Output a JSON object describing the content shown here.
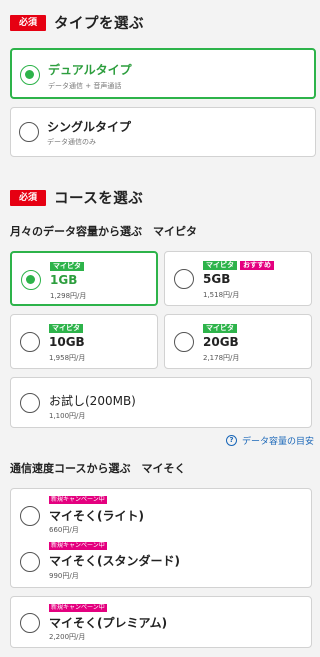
{
  "type_section": {
    "required": "必須",
    "title": "タイプを選ぶ",
    "options": [
      {
        "name": "デュアルタイプ",
        "desc": "データ通信 + 音声通話",
        "selected": true
      },
      {
        "name": "シングルタイプ",
        "desc": "データ通信のみ",
        "selected": false
      }
    ]
  },
  "course_section": {
    "required": "必須",
    "title": "コースを選ぶ",
    "capacity_heading": "月々のデータ容量から選ぶ　マイピタ",
    "badge_mypita": "マイピタ",
    "badge_recommended": "おすすめ",
    "plans": [
      {
        "name": "1GB",
        "price": "1,298円/月",
        "selected": true
      },
      {
        "name": "5GB",
        "price": "1,518円/月",
        "selected": false
      },
      {
        "name": "10GB",
        "price": "1,958円/月",
        "selected": false
      },
      {
        "name": "20GB",
        "price": "2,178円/月",
        "selected": false
      },
      {
        "name": "お試し(200MB)",
        "price": "1,100円/月",
        "selected": false
      }
    ],
    "help_link": "データ容量の目安",
    "speed_heading": "通信速度コースから選ぶ　マイそく",
    "campaign_badge": "新規キャンペーン中",
    "speed_plans": [
      {
        "name": "マイそく(ライト)",
        "price": "660円/月"
      },
      {
        "name": "マイそく(スタンダード)",
        "price": "990円/月"
      },
      {
        "name": "マイそく(プレミアム)",
        "price": "2,200円/月"
      }
    ]
  },
  "colors": {
    "accent_green": "#2db34a",
    "required_red": "#e60012",
    "campaign_pink": "#e4007f",
    "link_blue": "#1a67b8"
  }
}
